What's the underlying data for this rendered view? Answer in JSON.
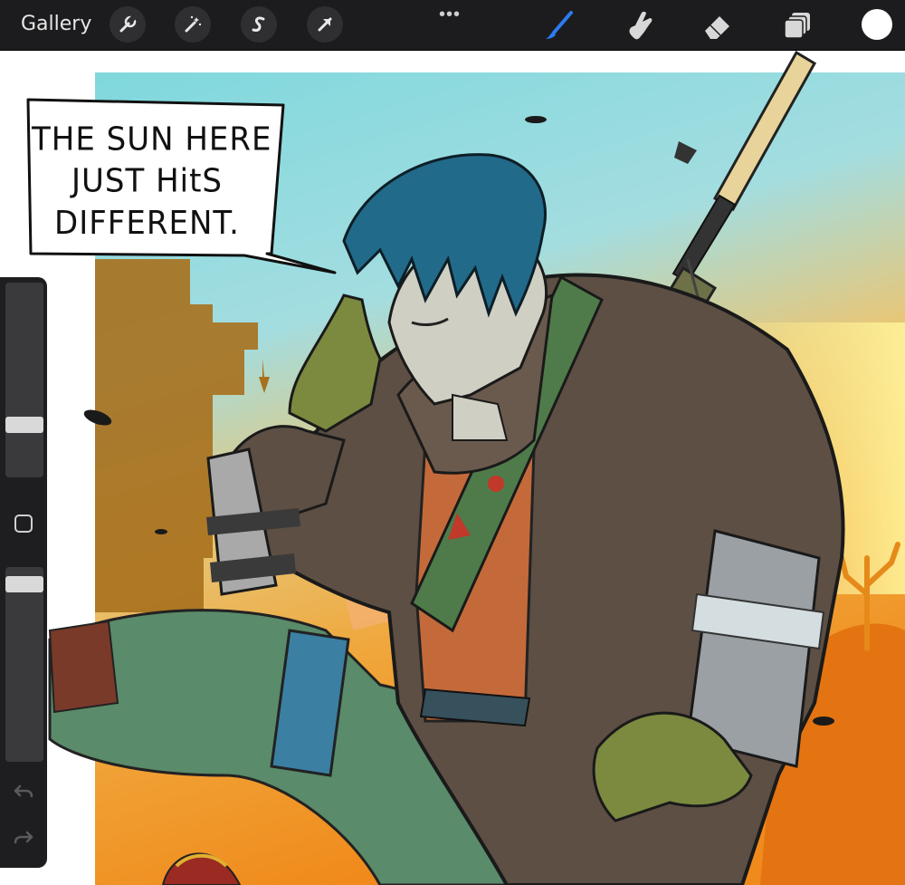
{
  "toolbar": {
    "gallery_label": "Gallery",
    "more_label": "•••",
    "left_tools": [
      "wrench-icon",
      "magic-wand-icon",
      "selection-s-icon",
      "transform-arrow-icon"
    ],
    "right_tools": [
      "brush-icon",
      "smudge-icon",
      "eraser-icon",
      "layers-icon",
      "color-swatch"
    ],
    "active_tool": "brush-icon",
    "accent_color": "#2b7bf2",
    "current_color": "#ffffff"
  },
  "canvas": {
    "speech_bubble": {
      "lines": [
        "THE SUN  HERE",
        "JUST HitS",
        "DIFFERENT."
      ]
    }
  },
  "sidebar": {
    "brush_size_level": 0.25,
    "opacity_level": 0.95,
    "tools": [
      "modify-square-icon",
      "undo-icon",
      "redo-icon"
    ]
  }
}
